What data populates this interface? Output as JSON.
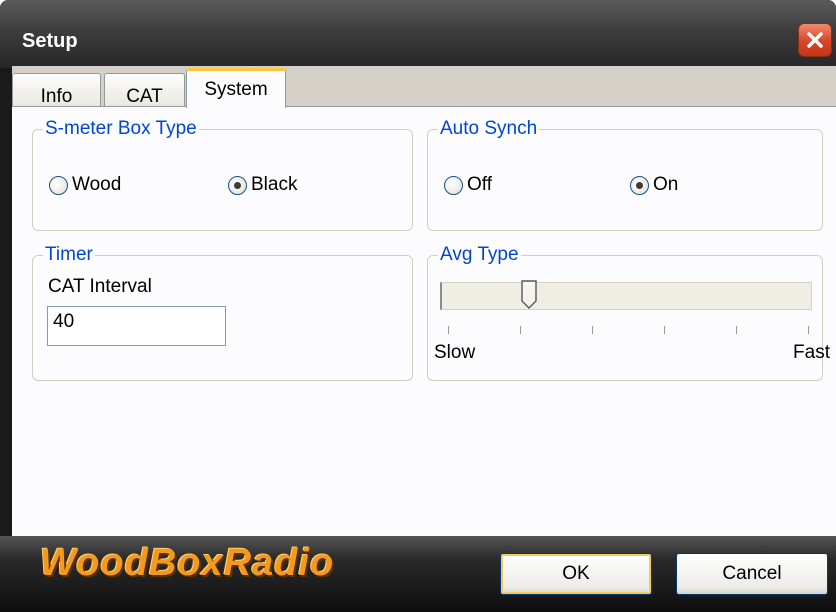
{
  "window": {
    "title": "Setup"
  },
  "tabs": [
    {
      "label": "Info",
      "selected": false
    },
    {
      "label": "CAT",
      "selected": false
    },
    {
      "label": "System",
      "selected": true
    }
  ],
  "smeter": {
    "title": "S-meter Box Type",
    "options": [
      {
        "label": "Wood",
        "checked": false
      },
      {
        "label": "Black",
        "checked": true
      }
    ]
  },
  "autosynch": {
    "title": "Auto Synch",
    "options": [
      {
        "label": "Off",
        "checked": false
      },
      {
        "label": "On",
        "checked": true
      }
    ]
  },
  "timer": {
    "title": "Timer",
    "cat_interval_label": "CAT Interval",
    "cat_interval_value": "40"
  },
  "avg": {
    "title": "Avg Type",
    "min_label": "Slow",
    "max_label": "Fast",
    "tick_count": 6,
    "value_index": 1
  },
  "footer": {
    "brand": "WoodBoxRadio",
    "ok_label": "OK",
    "cancel_label": "Cancel"
  },
  "colors": {
    "legend": "#0046d5",
    "brand": "#f39a1e",
    "tab_highlight": "#ffc83c",
    "close": "#d4462a"
  },
  "icons": {
    "close": "close-icon",
    "thumb": "slider-thumb-icon"
  }
}
